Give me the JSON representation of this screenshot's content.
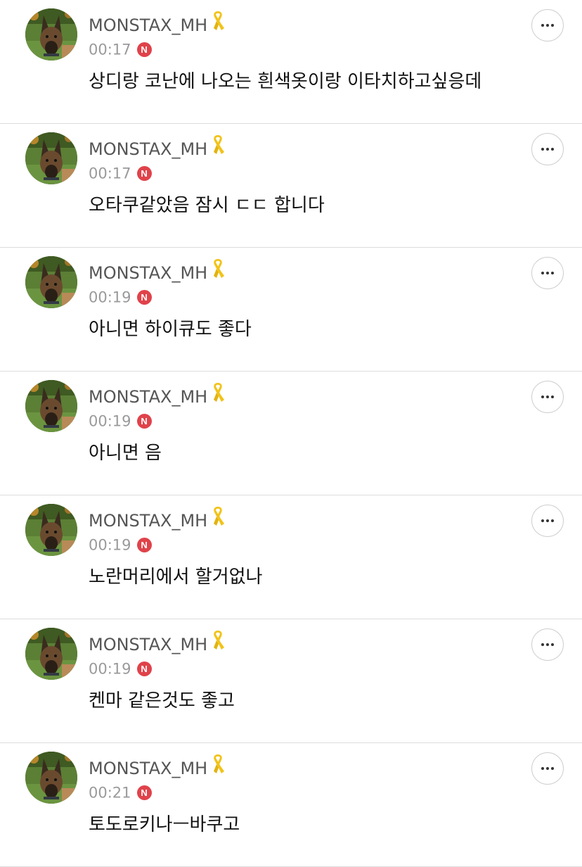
{
  "colors": {
    "badge": "#e0424a",
    "ribbon": "#f2c318",
    "divider": "#dcdcdc",
    "text": "#111111",
    "muted": "#9a9a9a"
  },
  "icons": {
    "ribbon": "yellow-ribbon-icon",
    "badge": "new-badge-icon",
    "more": "more-options-icon",
    "avatar": "dog-profile-picture"
  },
  "posts": [
    {
      "username": "MONSTAX_MH",
      "time": "00:17",
      "badge": "N",
      "text": "상디랑 코난에 나오는 흰색옷이랑 이타치하고싶응데"
    },
    {
      "username": "MONSTAX_MH",
      "time": "00:17",
      "badge": "N",
      "text": "오타쿠같았음 잠시 ㄷㄷ 합니다"
    },
    {
      "username": "MONSTAX_MH",
      "time": "00:19",
      "badge": "N",
      "text": "아니면 하이큐도 좋다"
    },
    {
      "username": "MONSTAX_MH",
      "time": "00:19",
      "badge": "N",
      "text": "아니면 음"
    },
    {
      "username": "MONSTAX_MH",
      "time": "00:19",
      "badge": "N",
      "text": "노란머리에서 할거없나"
    },
    {
      "username": "MONSTAX_MH",
      "time": "00:19",
      "badge": "N",
      "text": "켄마 같은것도 좋고"
    },
    {
      "username": "MONSTAX_MH",
      "time": "00:21",
      "badge": "N",
      "text": "토도로키나ㅡ바쿠고"
    }
  ]
}
